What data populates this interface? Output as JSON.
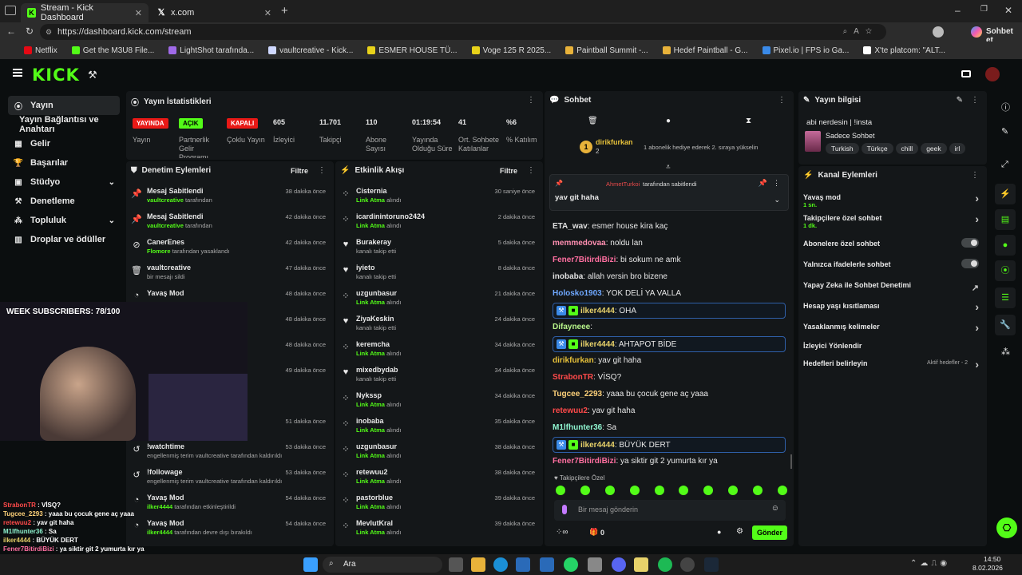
{
  "browser": {
    "tabs": [
      {
        "title": "Stream - Kick Dashboard",
        "active": true
      },
      {
        "title": "x.com",
        "active": false
      }
    ],
    "url": "https://dashboard.kick.com/stream",
    "assistant_label": "Sohbet et",
    "bookmarks": [
      "Netflix",
      "Get the M3U8 File...",
      "LightShot tarafında...",
      "vaultcreative - Kick...",
      "ESMER HOUSE TÜ...",
      "Voge 125 R 2025...",
      "Paintball Summit -...",
      "Hedef Paintball - G...",
      "Pixel.io | FPS io Ga...",
      "X'te platcom: \"ALT..."
    ]
  },
  "sidebar": {
    "items": [
      {
        "label": "Yayın",
        "icon": "broadcast-icon",
        "active": true
      },
      {
        "label": "Yayın Bağlantısı ve Anahtarı",
        "icon": "",
        "active": false
      },
      {
        "label": "Gelir",
        "icon": "revenue-icon",
        "active": false
      },
      {
        "label": "Başarılar",
        "icon": "trophy-icon",
        "active": false
      },
      {
        "label": "Stüdyo",
        "icon": "studio-icon",
        "active": false
      },
      {
        "label": "Denetleme",
        "icon": "moderation-icon",
        "active": false
      },
      {
        "label": "Topluluk",
        "icon": "community-icon",
        "active": false
      },
      {
        "label": "Droplar ve ödüller",
        "icon": "drops-icon",
        "active": false
      }
    ]
  },
  "stats": {
    "title": "Yayın İstatistikleri",
    "items": [
      {
        "value": "YAYINDA",
        "label": "Yayın",
        "badge_color": "#e91916"
      },
      {
        "value": "AÇIK",
        "label": "Partnerlik Gelir Programı",
        "badge_color": "#53fc18"
      },
      {
        "value": "KAPALI",
        "label": "Çoklu Yayın",
        "badge_color": "#e91916"
      },
      {
        "value": "605",
        "label": "İzleyici"
      },
      {
        "value": "11.701",
        "label": "Takipçi"
      },
      {
        "value": "110",
        "label": "Abone Sayısı"
      },
      {
        "value": "01:19:54",
        "label": "Yayında Olduğu Süre"
      },
      {
        "value": "41",
        "label": "Ort. Sohbete Katılanlar"
      },
      {
        "value": "%6",
        "label": "% Katılım"
      }
    ]
  },
  "moderation": {
    "title": "Denetim Eylemleri",
    "filter": "Filtre",
    "rows": [
      {
        "icon": "pin-icon",
        "title": "Mesaj Sabitlendi",
        "user": "vaultcreative",
        "sub": "tarafından",
        "time": "38 dakika önce"
      },
      {
        "icon": "pin-icon",
        "title": "Mesaj Sabitlendi",
        "user": "vaultcreative",
        "sub": "tarafından",
        "time": "42 dakika önce"
      },
      {
        "icon": "ban-icon",
        "title": "CanerEnes",
        "user": "Flomore",
        "sub": "tarafından yasaklandı",
        "time": "42 dakika önce"
      },
      {
        "icon": "trash-icon",
        "title": "vaultcreative",
        "user": "",
        "sub": "bir mesajı sildi",
        "time": "47 dakika önce"
      },
      {
        "icon": "slow-icon",
        "title": "Yavaş Mod",
        "user": "",
        "sub": "",
        "time": "48 dakika önce"
      },
      {
        "icon": "slow-icon",
        "title": "",
        "user": "",
        "sub": "",
        "time": "48 dakika önce"
      },
      {
        "icon": "slow-icon",
        "title": "",
        "user": "",
        "sub": "kıldı",
        "time": "48 dakika önce"
      },
      {
        "icon": "slow-icon",
        "title": "",
        "user": "",
        "sub": "",
        "time": "49 dakika önce"
      },
      {
        "icon": "slow-icon",
        "title": "",
        "user": "",
        "sub": "",
        "time": ""
      },
      {
        "icon": "slow-icon",
        "title": "",
        "user": "",
        "sub": "",
        "time": "51 dakika önce"
      },
      {
        "icon": "undo-icon",
        "title": "!watchtime",
        "user": "vaultcreative",
        "sub": "engellenmiş terim vaultcreative tarafından kaldırıldı",
        "time": "53 dakika önce"
      },
      {
        "icon": "undo-icon",
        "title": "!followage",
        "user": "vaultcreative",
        "sub": "engellenmiş terim vaultcreative tarafından kaldırıldı",
        "time": "53 dakika önce"
      },
      {
        "icon": "slow-icon",
        "title": "Yavaş Mod",
        "user": "ilker4444",
        "sub": "tarafından etkinleştirildi",
        "time": "54 dakika önce"
      },
      {
        "icon": "slow-icon",
        "title": "Yavaş Mod",
        "user": "ilker4444",
        "sub": "tarafından devre dışı bırakıldı",
        "time": "54 dakika önce"
      }
    ]
  },
  "activity": {
    "title": "Etkinlik Akışı",
    "filter": "Filtre",
    "rows": [
      {
        "icon": "cluster-icon",
        "title": "Cisternia",
        "sub": "Link Atma",
        "sub2": "alındı",
        "time": "30 saniye önce"
      },
      {
        "icon": "cluster-icon",
        "title": "icardinintoruno2424",
        "sub": "Link Atma",
        "sub2": "alındı",
        "time": "2 dakika önce"
      },
      {
        "icon": "heart-icon",
        "title": "Burakeray",
        "sub": "",
        "sub2": "kanalı takip etti",
        "time": "5 dakika önce"
      },
      {
        "icon": "heart-icon",
        "title": "iyieto",
        "sub": "",
        "sub2": "kanalı takip etti",
        "time": "8 dakika önce"
      },
      {
        "icon": "cluster-icon",
        "title": "uzgunbasur",
        "sub": "Link Atma",
        "sub2": "alındı",
        "time": "21 dakika önce"
      },
      {
        "icon": "heart-icon",
        "title": "ZiyaKeskin",
        "sub": "",
        "sub2": "kanalı takip etti",
        "time": "24 dakika önce"
      },
      {
        "icon": "cluster-icon",
        "title": "keremcha",
        "sub": "Link Atma",
        "sub2": "alındı",
        "time": "34 dakika önce"
      },
      {
        "icon": "heart-icon",
        "title": "mixedbydab",
        "sub": "",
        "sub2": "kanalı takip etti",
        "time": "34 dakika önce"
      },
      {
        "icon": "cluster-icon",
        "title": "Nykssp",
        "sub": "Link Atma",
        "sub2": "alındı",
        "time": "34 dakika önce"
      },
      {
        "icon": "cluster-icon",
        "title": "inobaba",
        "sub": "Link Atma",
        "sub2": "alındı",
        "time": "35 dakika önce"
      },
      {
        "icon": "cluster-icon",
        "title": "uzgunbasur",
        "sub": "Link Atma",
        "sub2": "alındı",
        "time": "38 dakika önce"
      },
      {
        "icon": "cluster-icon",
        "title": "retewuu2",
        "sub": "Link Atma",
        "sub2": "alındı",
        "time": "38 dakika önce"
      },
      {
        "icon": "cluster-icon",
        "title": "pastorblue",
        "sub": "Link Atma",
        "sub2": "alındı",
        "time": "39 dakika önce"
      },
      {
        "icon": "cluster-icon",
        "title": "MevlutKral",
        "sub": "Link Atma",
        "sub2": "alındı",
        "time": "39 dakika önce"
      }
    ]
  },
  "chat": {
    "title": "Sohbet",
    "gift_user": "dirikfurkan",
    "gift_count": "2",
    "gift_text": "1 abonelik hediye ederek 2. sıraya yükselin",
    "pinned_by": "AhmetTurkoi",
    "pinned_by_text": "tarafından sabitlendi",
    "pinned_msg": "yav git haha",
    "messages": [
      {
        "user": "ETA_wav",
        "text": "esmer house kira kaç",
        "color": "#e0e0e0",
        "hl": false
      },
      {
        "user": "memmedovaa",
        "text": "noldu lan",
        "color": "#ff8fb1",
        "hl": false
      },
      {
        "user": "Fener7BitirdiBizi",
        "text": "bi sokum ne amk",
        "color": "#ff6fa0",
        "hl": false
      },
      {
        "user": "inobaba",
        "text": "allah versin bro bizene",
        "color": "#e0e0e0",
        "hl": false
      },
      {
        "user": "Holosko1903",
        "text": "YOK DELİ YA VALLA",
        "color": "#6fa8ff",
        "hl": false
      },
      {
        "user": "ilker4444",
        "text": "OHA",
        "color": "#e8d26a",
        "hl": true
      },
      {
        "user": "Difayneee",
        "text": "",
        "color": "#b8f58a",
        "hl": false
      },
      {
        "user": "ilker4444",
        "text": "AHTAPOT BİDE",
        "color": "#e8d26a",
        "hl": true
      },
      {
        "user": "dirikfurkan",
        "text": "yav git haha",
        "color": "#e8c23a",
        "hl": false
      },
      {
        "user": "StrabonTR",
        "text": "VİSQ?",
        "color": "#ff4a4a",
        "hl": false
      },
      {
        "user": "Tugcee_2293",
        "text": "yaaa bu çocuk gene aç yaaa",
        "color": "#ffd27a",
        "hl": false
      },
      {
        "user": "retewuu2",
        "text": "yav git haha",
        "color": "#ff4a4a",
        "hl": false
      },
      {
        "user": "M1lfhunter36",
        "text": "Sa",
        "color": "#8ff5d0",
        "hl": false
      },
      {
        "user": "ilker4444",
        "text": "BÜYÜK DERT",
        "color": "#e8d26a",
        "hl": true
      },
      {
        "user": "Fener7BitirdiBizi",
        "text": "ya siktir git 2 yumurta kır ya",
        "color": "#ff6fa0",
        "hl": false
      }
    ],
    "followers_only": "Takipçilere Özel",
    "input_placeholder": "Bir mesaj gönderin",
    "count": "0",
    "send_label": "Gönder"
  },
  "stream_info": {
    "title": "Yayın bilgisi",
    "stream_title": "abi nerdesin | !insta",
    "category": "Sadece Sohbet",
    "tags": [
      "Turkish",
      "Türkçe",
      "chill",
      "geek",
      "irl"
    ]
  },
  "channel_actions": {
    "title": "Kanal Eylemleri",
    "items": [
      {
        "label": "Yavaş mod",
        "sub": "1 sn.",
        "control": "chevron"
      },
      {
        "label": "Takipçilere özel sohbet",
        "sub": "1 dk.",
        "control": "chevron"
      },
      {
        "label": "Abonelere özel sohbet",
        "sub": "",
        "control": "toggle"
      },
      {
        "label": "Yalnızca ifadelerle sohbet",
        "sub": "",
        "control": "toggle"
      },
      {
        "label": "Yapay Zeka ile Sohbet Denetimi",
        "sub": "",
        "control": "external"
      },
      {
        "label": "Hesap yaşı kısıtlaması",
        "sub": "",
        "control": "chevron"
      },
      {
        "label": "Yasaklanmış kelimeler",
        "sub": "",
        "control": "chevron"
      },
      {
        "label": "İzleyici Yönlendir",
        "sub": "",
        "control": "none"
      },
      {
        "label": "Hedefleri belirleyin",
        "sub": "",
        "control": "chevron",
        "extra": "Aktif hedefler - 2"
      }
    ]
  },
  "overlay": {
    "week_subs": "WEEK SUBSCRIBERS: 78/100",
    "chat": [
      {
        "user": "StrabonTR",
        "text": "VİSQ?",
        "color": "#ff4a4a"
      },
      {
        "user": "Tugcee_2293",
        "text": "yaaa bu çocuk gene aç yaaa",
        "color": "#ffd27a"
      },
      {
        "user": "retewuu2",
        "text": "yav git haha",
        "color": "#ff4a4a"
      },
      {
        "user": "M1lfhunter36",
        "text": "Sa",
        "color": "#8ff5d0"
      },
      {
        "user": "ilker4444",
        "text": "BÜYÜK DERT",
        "color": "#e8d26a"
      },
      {
        "user": "Fener7BitirdiBizi",
        "text": "ya siktir git 2 yumurta kır ya",
        "color": "#ff6fa0"
      }
    ]
  },
  "taskbar": {
    "search": "Ara",
    "time": "14:50",
    "date": "8.02.2026"
  },
  "colors": {
    "accent": "#53fc18",
    "panel": "#141719",
    "bg": "#0b0e0f"
  }
}
